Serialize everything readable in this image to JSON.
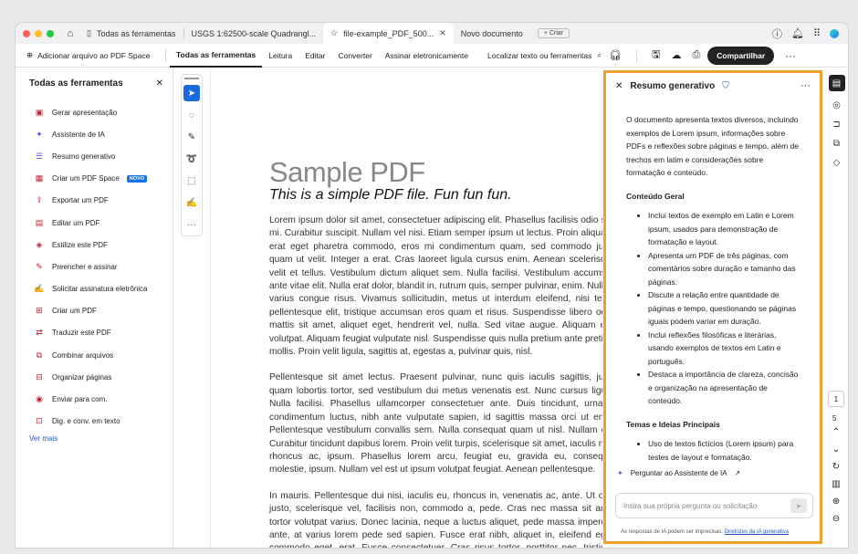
{
  "colors": {
    "accent": "#1b6ae0",
    "panel_border": "#f0a030",
    "badge": "#1673e6"
  },
  "browser": {
    "tabs": [
      {
        "label": "Todas as ferramentas",
        "icon": "panel-icon",
        "closable": false
      },
      {
        "label": "USGS 1:62500-scale Quadrangl...",
        "icon": "",
        "closable": false
      },
      {
        "label": "file-example_PDF_500...",
        "icon": "star-icon",
        "closable": true,
        "active": true
      },
      {
        "label": "Novo documento",
        "icon": "",
        "closable": false
      }
    ],
    "new_tab_label": "+ Criar"
  },
  "toolbar": {
    "add_file": "Adicionar arquivo ao PDF Space",
    "menu": [
      "Todas as ferramentas",
      "Leitura",
      "Editar",
      "Converter",
      "Assinar eletronicamente"
    ],
    "find": "Localizar texto ou ferramentas",
    "share": "Compartilhar"
  },
  "left_panel": {
    "title": "Todas as ferramentas",
    "tools": [
      {
        "label": "Gerar apresentação",
        "icon": "presentation-icon"
      },
      {
        "label": "Assistente de IA",
        "icon": "ai-assistant-icon"
      },
      {
        "label": "Resumo generativo",
        "icon": "summary-icon"
      },
      {
        "label": "Criar um PDF Space",
        "icon": "pdf-space-icon",
        "badge": "NOVO"
      },
      {
        "label": "Exportar um PDF",
        "icon": "export-icon"
      },
      {
        "label": "Editar um PDF",
        "icon": "edit-pdf-icon"
      },
      {
        "label": "Estilize este PDF",
        "icon": "style-icon"
      },
      {
        "label": "Preencher e assinar",
        "icon": "fill-sign-icon"
      },
      {
        "label": "Solicitar assinatura eletrônica",
        "icon": "request-signature-icon"
      },
      {
        "label": "Criar um PDF",
        "icon": "create-pdf-icon"
      },
      {
        "label": "Traduzir este PDF",
        "icon": "translate-icon"
      },
      {
        "label": "Combinar arquivos",
        "icon": "combine-icon"
      },
      {
        "label": "Organizar páginas",
        "icon": "organize-icon"
      },
      {
        "label": "Enviar para com.",
        "icon": "send-comments-icon"
      },
      {
        "label": "Dig. e conv. em texto",
        "icon": "scan-icon"
      }
    ],
    "more": "Ver mais"
  },
  "document": {
    "title": "Sample PDF",
    "subtitle": "This is a simple PDF file. Fun fun fun.",
    "paragraphs": [
      "Lorem ipsum dolor sit amet, consectetuer adipiscing elit. Phasellus facilisis odio sed mi. Curabitur suscipit. Nullam vel nisi. Etiam semper ipsum ut lectus. Proin aliquam, erat eget pharetra commodo, eros mi condimentum quam, sed commodo justo quam ut velit. Integer a erat. Cras laoreet ligula cursus enim. Aenean scelerisque velit et tellus. Vestibulum dictum aliquet sem. Nulla facilisi. Vestibulum accumsan ante vitae elit. Nulla erat dolor, blandit in, rutrum quis, semper pulvinar, enim. Nullam varius congue risus. Vivamus sollicitudin, metus ut interdum eleifend, nisi tellus pellentesque elit, tristique accumsan eros quam et risus. Suspendisse libero odio, mattis sit amet, aliquet eget, hendrerit vel, nulla. Sed vitae augue. Aliquam erat volutpat. Aliquam feugiat vulputate nisl. Suspendisse quis nulla pretium ante pretium mollis. Proin velit ligula, sagittis at, egestas a, pulvinar quis, nisl.",
      "Pellentesque sit amet lectus. Praesent pulvinar, nunc quis iaculis sagittis, justo quam lobortis tortor, sed vestibulum dui metus venenatis est. Nunc cursus ligula. Nulla facilisi. Phasellus ullamcorper consectetuer ante. Duis tincidunt, urna id condimentum luctus, nibh ante vulputate sapien, id sagittis massa orci ut enim. Pellentesque vestibulum convallis sem. Nulla consequat quam ut nisl. Nullam est. Curabitur tincidunt dapibus lorem. Proin velit turpis, scelerisque sit amet, iaculis nec, rhoncus ac, ipsum. Phasellus lorem arcu, feugiat eu, gravida eu, consequat molestie, ipsum. Nullam vel est ut ipsum volutpat feugiat. Aenean pellentesque.",
      "In mauris. Pellentesque dui nisi, iaculis eu, rhoncus in, venenatis ac, ante. Ut odio justo, scelerisque vel, facilisis non, commodo a, pede. Cras nec massa sit amet tortor volutpat varius. Donec lacinia, neque a luctus aliquet, pede massa imperdiet ante, at varius lorem pede sed sapien. Fusce erat nibh, aliquet in, eleifend eget, commodo eget, erat. Fusce consectetuer. Cras risus tortor, porttitor nec, tristique sed, convallis semper, eros."
    ]
  },
  "ai_panel": {
    "title": "Resumo generativo",
    "intro": "O documento apresenta textos diversos, incluindo exemplos de Lorem ipsum, informações sobre PDFs e reflexões sobre páginas e tempo, além de trechos em latim e considerações sobre formatação e conteúdo.",
    "section1_title": "Conteúdo Geral",
    "section1_items": [
      "Inclui textos de exemplo em Latin e Lorem ipsum, usados para demonstração de formatação e layout.",
      "Apresenta um PDF de três páginas, com comentários sobre duração e tamanho das páginas.",
      "Discute a relação entre quantidade de páginas e tempo, questionando se páginas iguais podem variar em duração.",
      "Inclui reflexões filosóficas e literárias, usando exemplos de textos em Latin e português.",
      "Destaca a importância de clareza, concisão e organização na apresentação de conteúdo."
    ],
    "section2_title": "Temas e Ideias Principais",
    "section2_items": [
      "Uso de textos fictícios (Lorem ipsum) para testes de layout e formatação."
    ],
    "ask_label": "Perguntar ao Assistente de IA",
    "prompt_placeholder": "Insira sua própria pergunta ou solicitação",
    "disclaimer": "As respostas de IA podem ser imprecisas.",
    "disclaimer_link": "Diretrizes da IA generativa"
  },
  "pagination": {
    "current": "1",
    "total": "5"
  }
}
